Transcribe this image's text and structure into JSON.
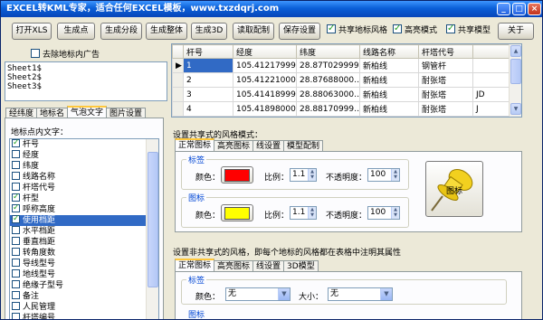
{
  "window": {
    "title": "EXCEL转KML专家，适合任何EXCEL模板，www.txzdqrj.com",
    "min_label": "_",
    "max_label": "□",
    "close_label": "×"
  },
  "toolbar": {
    "buttons": [
      "打开XLS",
      "生成点",
      "生成分段",
      "生成整体",
      "生成3D",
      "读取配制",
      "保存设置"
    ],
    "close_label": "关于",
    "checks": [
      {
        "label": "共享地标风格",
        "checked": true
      },
      {
        "label": "高亮模式",
        "checked": true
      },
      {
        "label": "共享模型",
        "checked": true
      }
    ]
  },
  "left": {
    "ad_check": {
      "label": "去除地标内广告",
      "checked": false
    },
    "sheets": [
      "Sheet1$",
      "Sheet2$",
      "Sheet3$"
    ],
    "tabs": [
      "经纬度",
      "地标名",
      "气泡文字",
      "图片设置"
    ],
    "active_tab": 2,
    "bubble_label": "地标点内文字：",
    "fields": [
      {
        "label": "杆号",
        "checked": true,
        "selected": false
      },
      {
        "label": "经度",
        "checked": false,
        "selected": false
      },
      {
        "label": "纬度",
        "checked": false,
        "selected": false
      },
      {
        "label": "线路名称",
        "checked": false,
        "selected": false
      },
      {
        "label": "杆塔代号",
        "checked": false,
        "selected": false
      },
      {
        "label": "杆型",
        "checked": true,
        "selected": false
      },
      {
        "label": "呼称高度",
        "checked": true,
        "selected": false
      },
      {
        "label": "使用档距",
        "checked": true,
        "selected": true
      },
      {
        "label": "水平档距",
        "checked": false,
        "selected": false
      },
      {
        "label": "垂直档距",
        "checked": false,
        "selected": false
      },
      {
        "label": "转角度数",
        "checked": false,
        "selected": false
      },
      {
        "label": "导线型号",
        "checked": false,
        "selected": false
      },
      {
        "label": "地线型号",
        "checked": false,
        "selected": false
      },
      {
        "label": "绝缘子型号",
        "checked": false,
        "selected": false
      },
      {
        "label": "备注",
        "checked": false,
        "selected": false
      },
      {
        "label": "人民管理",
        "checked": false,
        "selected": false
      },
      {
        "label": "杆塔编号",
        "checked": false,
        "selected": false
      }
    ]
  },
  "grid": {
    "columns": [
      "杆号",
      "经度",
      "纬度",
      "线路名称",
      "杆塔代号"
    ],
    "rows": [
      [
        "1",
        "105.41217999…",
        "28.87T029999…",
        "新柏线",
        "钢管杆"
      ],
      [
        "2",
        "105.41221000…",
        "28.87688000…",
        "新柏线",
        "耐张塔"
      ],
      [
        "3",
        "105.41418999…",
        "28.88063000…",
        "新柏线",
        "耐张塔"
      ],
      [
        "4",
        "105.41898000…",
        "28.88170999…",
        "新柏线",
        "耐张塔"
      ]
    ],
    "extra_col_values": [
      "",
      "",
      "JD",
      "J"
    ]
  },
  "shared_style": {
    "title": "设置共享式的风格模式：",
    "tabs": [
      "正常图标",
      "高亮图标",
      "线设置",
      "模型配制"
    ],
    "label_group": {
      "title": "标签",
      "color_label": "颜色：",
      "color": "#ff0000",
      "ratio_label": "比例：",
      "ratio": "1.1",
      "opacity_label": "不透明度：",
      "opacity": "100"
    },
    "icon_group": {
      "title": "图标",
      "color_label": "颜色：",
      "color": "#ffff00",
      "ratio_label": "比例：",
      "ratio": "1.1",
      "opacity_label": "不透明度：",
      "opacity": "100"
    },
    "pushpin_label": "图标"
  },
  "nonshared_style": {
    "title": "设置非共享式的风格，即每个地标的风格都在表格中注明其属性",
    "tabs": [
      "正常图标",
      "高亮图标",
      "线设置",
      "3D模型"
    ],
    "label_group_title": "标签",
    "color_label": "颜色：",
    "color_value": "无",
    "size_label": "大小：",
    "size_value": "无",
    "icon_group_title": "图标"
  }
}
